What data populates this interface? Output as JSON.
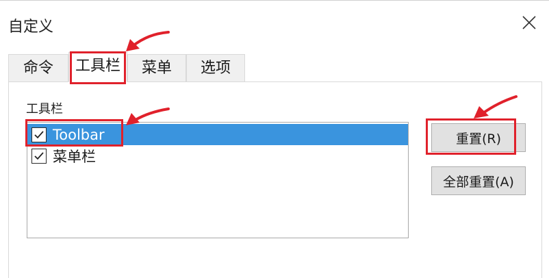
{
  "window": {
    "title": "自定义",
    "close_icon": "close-icon"
  },
  "tabs": [
    {
      "label": "命令",
      "active": false
    },
    {
      "label": "工具栏",
      "active": true
    },
    {
      "label": "菜单",
      "active": false
    },
    {
      "label": "选项",
      "active": false
    }
  ],
  "toolbar_section": {
    "label": "工具栏",
    "items": [
      {
        "label": "Toolbar",
        "checked": true,
        "selected": true
      },
      {
        "label": "菜单栏",
        "checked": true,
        "selected": false
      }
    ]
  },
  "buttons": {
    "reset": "重置(R)",
    "reset_all": "全部重置(A)"
  },
  "colors": {
    "selection": "#3a94de",
    "annotation": "#e0212b",
    "button_face": "#e1e1e1"
  }
}
